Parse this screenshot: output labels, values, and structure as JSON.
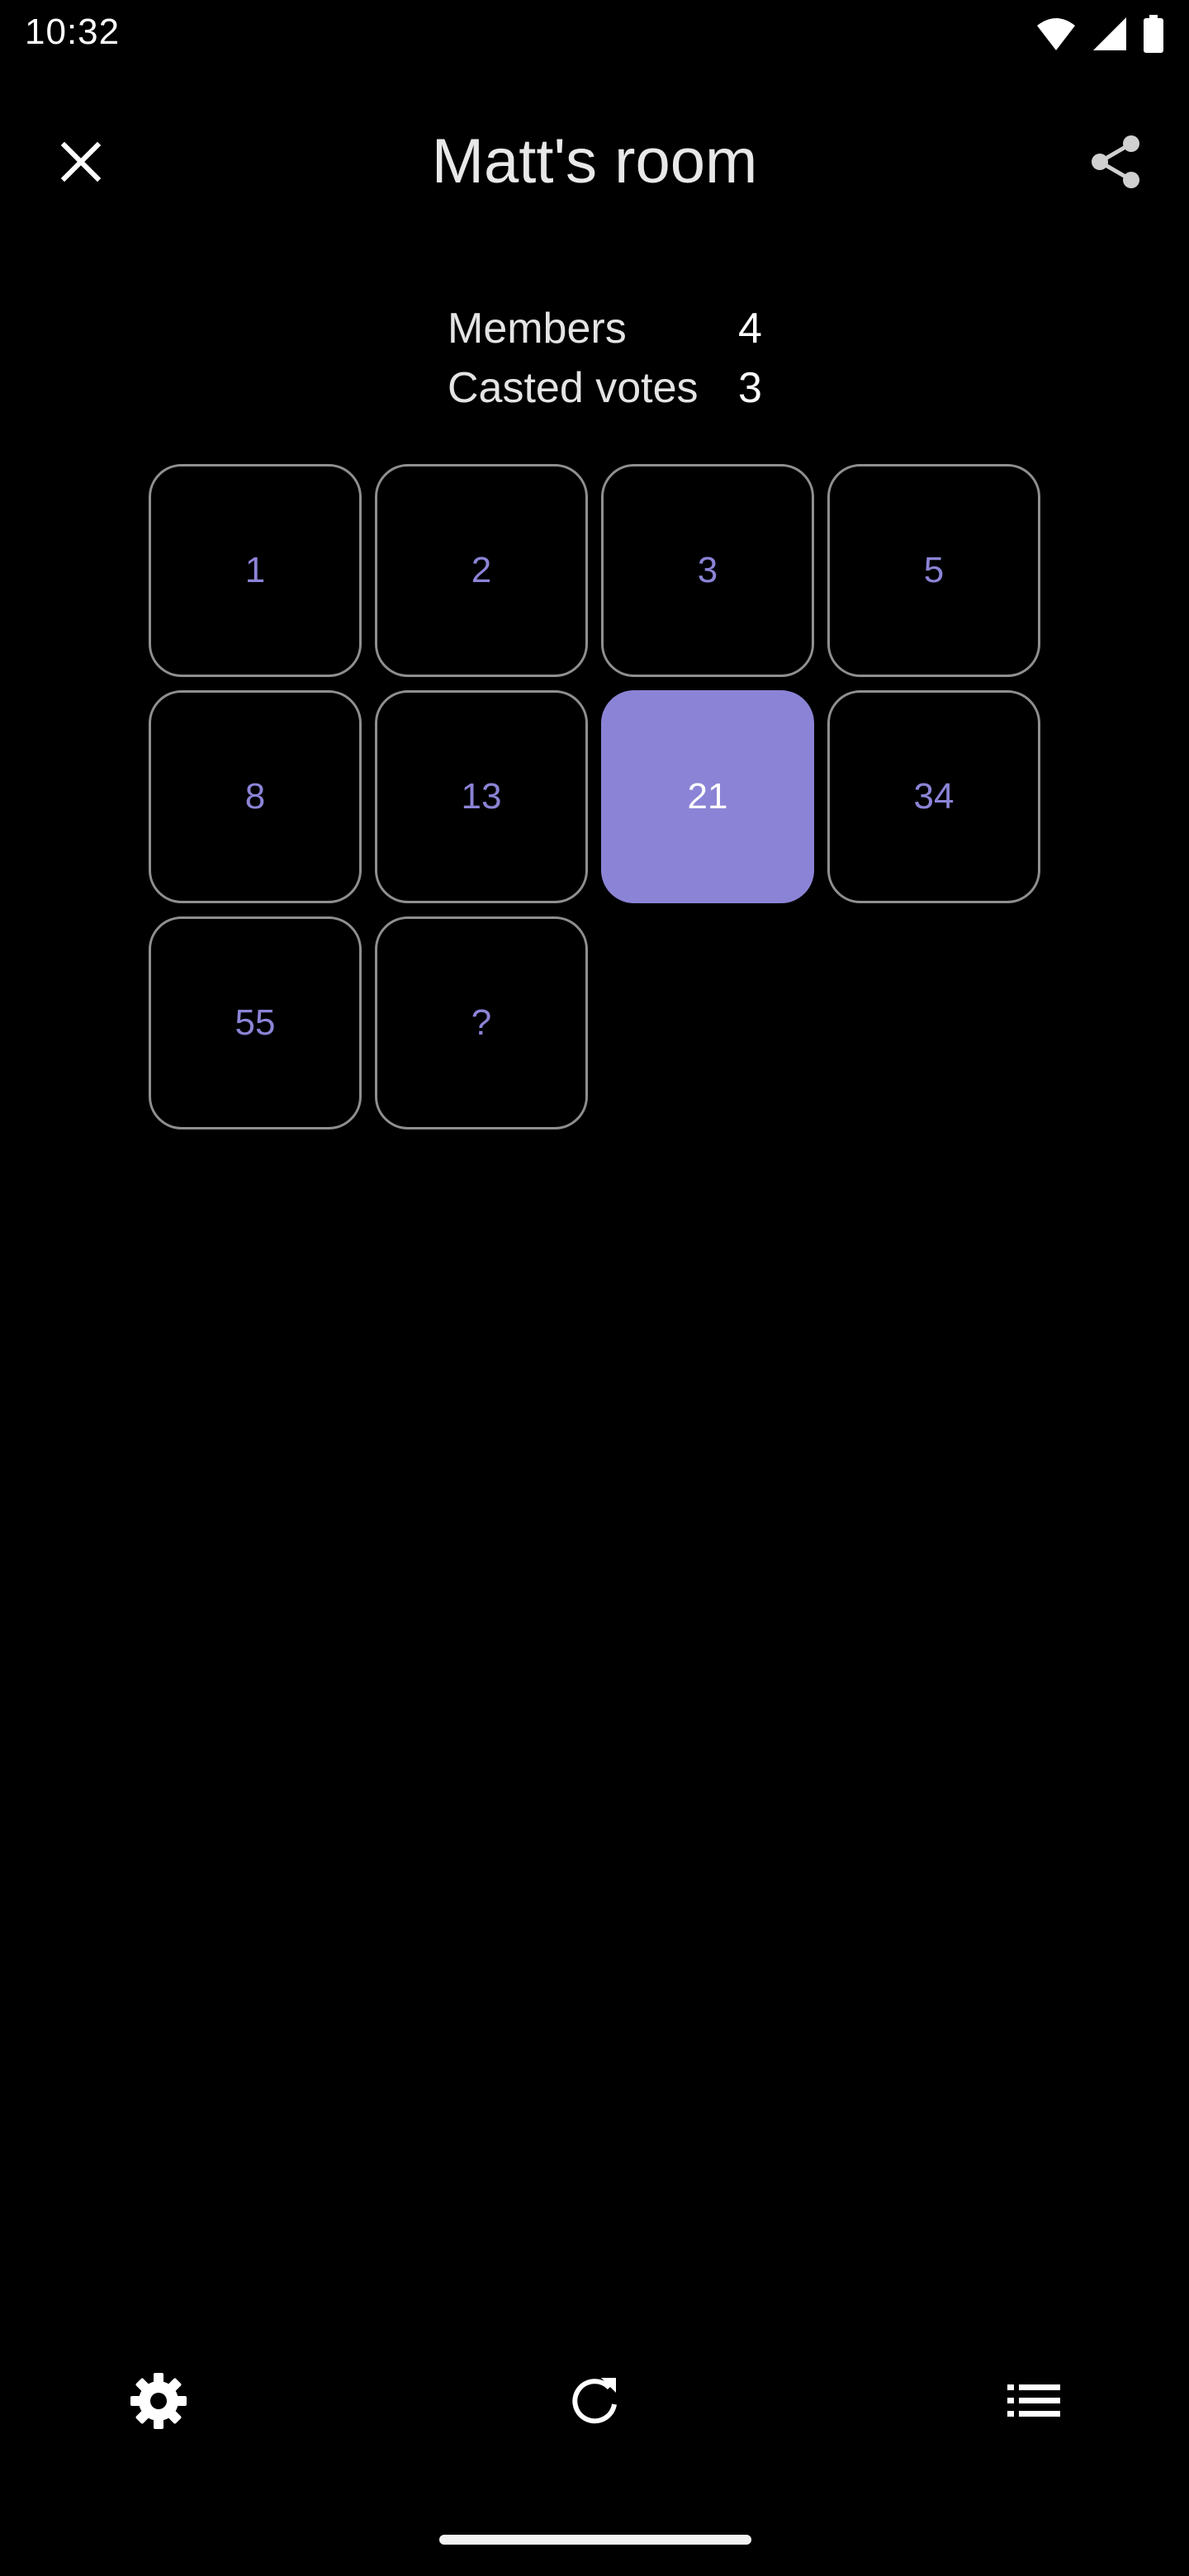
{
  "status_bar": {
    "time": "10:32",
    "icons": [
      "wifi-icon",
      "cellular-signal-icon",
      "battery-icon"
    ]
  },
  "app_bar": {
    "title": "Matt's room",
    "close_icon": "close-icon",
    "share_icon": "share-icon"
  },
  "stats": {
    "members_label": "Members",
    "members_value": "4",
    "votes_label": "Casted votes",
    "votes_value": "3"
  },
  "cards": [
    {
      "label": "1",
      "selected": false
    },
    {
      "label": "2",
      "selected": false
    },
    {
      "label": "3",
      "selected": false
    },
    {
      "label": "5",
      "selected": false
    },
    {
      "label": "8",
      "selected": false
    },
    {
      "label": "13",
      "selected": false
    },
    {
      "label": "21",
      "selected": true
    },
    {
      "label": "34",
      "selected": false
    },
    {
      "label": "55",
      "selected": false
    },
    {
      "label": "?",
      "selected": false
    }
  ],
  "bottom_bar": {
    "icons": [
      "settings-icon",
      "refresh-icon",
      "list-icon"
    ]
  },
  "colors": {
    "accent": "#8b84d6",
    "background": "#000000",
    "card_border": "#8f8f8f"
  }
}
